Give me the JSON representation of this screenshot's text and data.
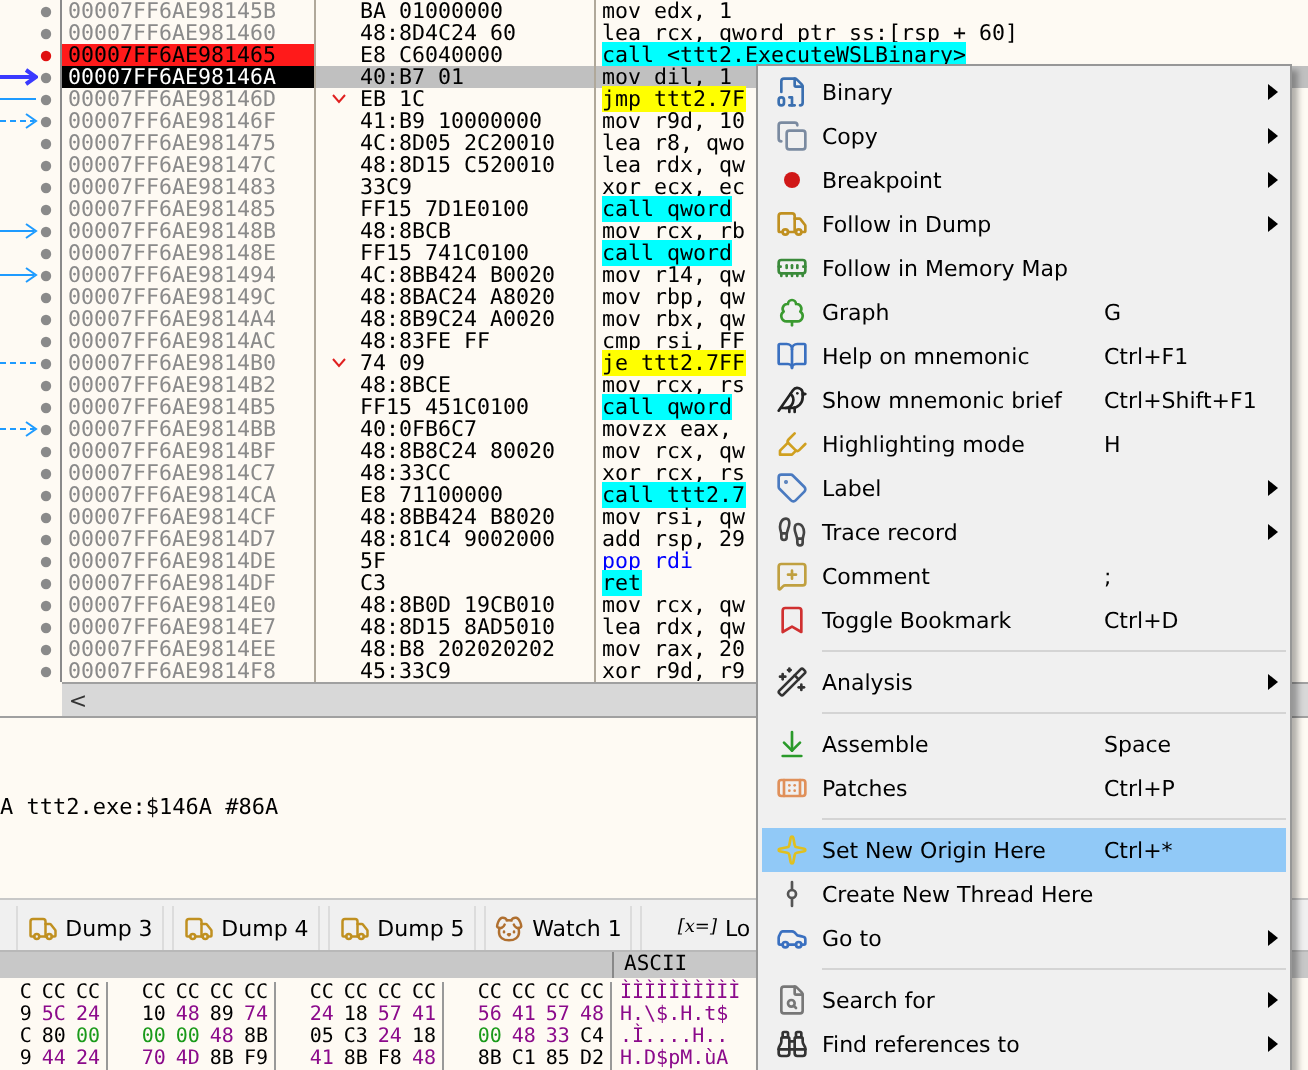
{
  "disassembly": {
    "rows": [
      {
        "address": "00007FF6AE98145B",
        "bytes": "BA 01000000",
        "instruction": "mov edx, 1",
        "kind": "plain",
        "breakpoint": false,
        "selected": false,
        "branch": false
      },
      {
        "address": "00007FF6AE981460",
        "bytes": "48:8D4C24 60",
        "instruction": "lea rcx, qword ptr ss:[rsp + 60]",
        "kind": "plain",
        "breakpoint": false,
        "selected": false,
        "branch": false
      },
      {
        "address": "00007FF6AE981465",
        "bytes": "E8 C6040000",
        "instruction": "call <ttt2.ExecuteWSLBinary>",
        "kind": "call",
        "breakpoint": true,
        "selected": false,
        "branch": false
      },
      {
        "address": "00007FF6AE98146A",
        "bytes": "40:B7 01",
        "instruction": "mov dil, 1",
        "kind": "plain",
        "breakpoint": false,
        "selected": true,
        "branch": false,
        "arrow": {
          "kind": "current"
        }
      },
      {
        "address": "00007FF6AE98146D",
        "bytes": "EB 1C",
        "instruction": "jmp ttt2.7F",
        "kind": "jump",
        "breakpoint": false,
        "selected": false,
        "branch": true,
        "arrow": {
          "kind": "line"
        }
      },
      {
        "address": "00007FF6AE98146F",
        "bytes": "41:B9 10000000",
        "instruction": "mov r9d, 10",
        "kind": "plain",
        "breakpoint": false,
        "selected": false,
        "branch": false,
        "arrow": {
          "kind": "dashed"
        }
      },
      {
        "address": "00007FF6AE981475",
        "bytes": "4C:8D05 2C20010",
        "instruction": "lea r8, qwo",
        "kind": "plain",
        "breakpoint": false,
        "selected": false,
        "branch": false
      },
      {
        "address": "00007FF6AE98147C",
        "bytes": "48:8D15 C520010",
        "instruction": "lea rdx, qw",
        "kind": "plain",
        "breakpoint": false,
        "selected": false,
        "branch": false
      },
      {
        "address": "00007FF6AE981483",
        "bytes": "33C9",
        "instruction": "xor ecx, ec",
        "kind": "plain",
        "breakpoint": false,
        "selected": false,
        "branch": false
      },
      {
        "address": "00007FF6AE981485",
        "bytes": "FF15 7D1E0100",
        "instruction": "call qword",
        "kind": "call",
        "breakpoint": false,
        "selected": false,
        "branch": false
      },
      {
        "address": "00007FF6AE98148B",
        "bytes": "48:8BCB",
        "instruction": "mov rcx, rb",
        "kind": "plain",
        "breakpoint": false,
        "selected": false,
        "branch": false,
        "arrow": {
          "kind": "solid"
        }
      },
      {
        "address": "00007FF6AE98148E",
        "bytes": "FF15 741C0100",
        "instruction": "call qword",
        "kind": "call",
        "breakpoint": false,
        "selected": false,
        "branch": false
      },
      {
        "address": "00007FF6AE981494",
        "bytes": "4C:8BB424 B0020",
        "instruction": "mov r14, qw",
        "kind": "plain",
        "breakpoint": false,
        "selected": false,
        "branch": false,
        "arrow": {
          "kind": "solid"
        }
      },
      {
        "address": "00007FF6AE98149C",
        "bytes": "48:8BAC24 A8020",
        "instruction": "mov rbp, qw",
        "kind": "plain",
        "breakpoint": false,
        "selected": false,
        "branch": false
      },
      {
        "address": "00007FF6AE9814A4",
        "bytes": "48:8B9C24 A0020",
        "instruction": "mov rbx, qw",
        "kind": "plain",
        "breakpoint": false,
        "selected": false,
        "branch": false
      },
      {
        "address": "00007FF6AE9814AC",
        "bytes": "48:83FE FF",
        "instruction": "cmp rsi, FF",
        "kind": "plain",
        "breakpoint": false,
        "selected": false,
        "branch": false
      },
      {
        "address": "00007FF6AE9814B0",
        "bytes": "74 09",
        "instruction": "je ttt2.7FF",
        "kind": "jump",
        "breakpoint": false,
        "selected": false,
        "branch": true,
        "arrow": {
          "kind": "dashed-line"
        }
      },
      {
        "address": "00007FF6AE9814B2",
        "bytes": "48:8BCE",
        "instruction": "mov rcx, rs",
        "kind": "plain",
        "breakpoint": false,
        "selected": false,
        "branch": false
      },
      {
        "address": "00007FF6AE9814B5",
        "bytes": "FF15 451C0100",
        "instruction": "call qword",
        "kind": "call",
        "breakpoint": false,
        "selected": false,
        "branch": false
      },
      {
        "address": "00007FF6AE9814BB",
        "bytes": "40:0FB6C7",
        "instruction": "movzx eax,",
        "kind": "plain",
        "breakpoint": false,
        "selected": false,
        "branch": false,
        "arrow": {
          "kind": "dashed"
        }
      },
      {
        "address": "00007FF6AE9814BF",
        "bytes": "48:8B8C24 80020",
        "instruction": "mov rcx, qw",
        "kind": "plain",
        "breakpoint": false,
        "selected": false,
        "branch": false
      },
      {
        "address": "00007FF6AE9814C7",
        "bytes": "48:33CC",
        "instruction": "xor rcx, rs",
        "kind": "plain",
        "breakpoint": false,
        "selected": false,
        "branch": false
      },
      {
        "address": "00007FF6AE9814CA",
        "bytes": "E8 71100000",
        "instruction": "call ttt2.7",
        "kind": "call",
        "breakpoint": false,
        "selected": false,
        "branch": false
      },
      {
        "address": "00007FF6AE9814CF",
        "bytes": "48:8BB424 B8020",
        "instruction": "mov rsi, qw",
        "kind": "plain",
        "breakpoint": false,
        "selected": false,
        "branch": false
      },
      {
        "address": "00007FF6AE9814D7",
        "bytes": "48:81C4 9002000",
        "instruction": "add rsp, 29",
        "kind": "plain",
        "breakpoint": false,
        "selected": false,
        "branch": false
      },
      {
        "address": "00007FF6AE9814DE",
        "bytes": "5F",
        "instruction": "pop rdi",
        "kind": "stack",
        "breakpoint": false,
        "selected": false,
        "branch": false
      },
      {
        "address": "00007FF6AE9814DF",
        "bytes": "C3",
        "instruction": "ret",
        "kind": "call",
        "breakpoint": false,
        "selected": false,
        "branch": false
      },
      {
        "address": "00007FF6AE9814E0",
        "bytes": "48:8B0D 19CB010",
        "instruction": "mov rcx, qw",
        "kind": "plain",
        "breakpoint": false,
        "selected": false,
        "branch": false
      },
      {
        "address": "00007FF6AE9814E7",
        "bytes": "48:8D15 8AD5010",
        "instruction": "lea rdx, qw",
        "kind": "plain",
        "breakpoint": false,
        "selected": false,
        "branch": false
      },
      {
        "address": "00007FF6AE9814EE",
        "bytes": "48:B8 202020202",
        "instruction": "mov rax, 20",
        "kind": "plain",
        "breakpoint": false,
        "selected": false,
        "branch": false
      },
      {
        "address": "00007FF6AE9814F8",
        "bytes": "45:33C9",
        "instruction": "xor r9d, r9",
        "kind": "plain",
        "breakpoint": false,
        "selected": false,
        "branch": false
      }
    ],
    "scroll_left": "<"
  },
  "info_panel": {
    "text": "A ttt2.exe:$146A #86A"
  },
  "tabs": [
    {
      "label": "Dump 3"
    },
    {
      "label": "Dump 4"
    },
    {
      "label": "Dump 5"
    },
    {
      "label": "Watch 1"
    },
    {
      "label": "Lo",
      "badge": "[x=]"
    }
  ],
  "hex_dump": {
    "ascii_header": "ASCII",
    "rows": [
      {
        "bytes": [
          "C",
          "CC",
          "CC",
          "CC",
          "CC",
          "CC",
          "CC",
          "CC",
          "CC",
          "CC",
          "CC",
          "CC",
          "CC",
          "CC",
          "CC"
        ],
        "ascii": "ÌÌÌÌÌÌÌÌÌÌ"
      },
      {
        "bytes": [
          "9",
          "5C",
          "24",
          "10",
          "48",
          "89",
          "74",
          "24",
          "18",
          "57",
          "41",
          "56",
          "41",
          "57",
          "48"
        ],
        "ascii": "H.\\$.H.t$"
      },
      {
        "bytes": [
          "C",
          "80",
          "00",
          "00",
          "00",
          "48",
          "8B",
          "05",
          "C3",
          "24",
          "18",
          "00",
          "48",
          "33",
          "C4"
        ],
        "ascii": ".Ì....H.."
      },
      {
        "bytes": [
          "9",
          "44",
          "24",
          "70",
          "4D",
          "8B",
          "F9",
          "41",
          "8B",
          "F8",
          "48",
          "8B",
          "C1",
          "85",
          "D2"
        ],
        "ascii": "H.D$pM.ùA"
      }
    ]
  },
  "context_menu": {
    "items": [
      {
        "kind": "item",
        "label": "Binary",
        "submenu": true,
        "selected": false
      },
      {
        "kind": "item",
        "label": "Copy",
        "submenu": true,
        "selected": false
      },
      {
        "kind": "item",
        "label": "Breakpoint",
        "submenu": true,
        "selected": false
      },
      {
        "kind": "item",
        "label": "Follow in Dump",
        "submenu": true,
        "selected": false
      },
      {
        "kind": "item",
        "label": "Follow in Memory Map",
        "submenu": false,
        "selected": false
      },
      {
        "kind": "item",
        "label": "Graph",
        "shortcut": "G",
        "submenu": false,
        "selected": false
      },
      {
        "kind": "item",
        "label": "Help on mnemonic",
        "shortcut": "Ctrl+F1",
        "submenu": false,
        "selected": false
      },
      {
        "kind": "item",
        "label": "Show mnemonic brief",
        "shortcut": "Ctrl+Shift+F1",
        "submenu": false,
        "selected": false
      },
      {
        "kind": "item",
        "label": "Highlighting mode",
        "shortcut": "H",
        "submenu": false,
        "selected": false
      },
      {
        "kind": "item",
        "label": "Label",
        "submenu": true,
        "selected": false
      },
      {
        "kind": "item",
        "label": "Trace record",
        "submenu": true,
        "selected": false
      },
      {
        "kind": "item",
        "label": "Comment",
        "shortcut": ";",
        "submenu": false,
        "selected": false
      },
      {
        "kind": "item",
        "label": "Toggle Bookmark",
        "shortcut": "Ctrl+D",
        "submenu": false,
        "selected": false
      },
      {
        "kind": "separator"
      },
      {
        "kind": "item",
        "label": "Analysis",
        "submenu": true,
        "selected": false
      },
      {
        "kind": "separator"
      },
      {
        "kind": "item",
        "label": "Assemble",
        "shortcut": "Space",
        "submenu": false,
        "selected": false
      },
      {
        "kind": "item",
        "label": "Patches",
        "shortcut": "Ctrl+P",
        "submenu": false,
        "selected": false
      },
      {
        "kind": "separator"
      },
      {
        "kind": "item",
        "label": "Set New Origin Here",
        "shortcut": "Ctrl+*",
        "submenu": false,
        "selected": true
      },
      {
        "kind": "item",
        "label": "Create New Thread Here",
        "submenu": false,
        "selected": false
      },
      {
        "kind": "item",
        "label": "Go to",
        "submenu": true,
        "selected": false
      },
      {
        "kind": "separator"
      },
      {
        "kind": "item",
        "label": "Search for",
        "submenu": true,
        "selected": false
      },
      {
        "kind": "item",
        "label": "Find references to",
        "submenu": true,
        "selected": false
      }
    ]
  }
}
